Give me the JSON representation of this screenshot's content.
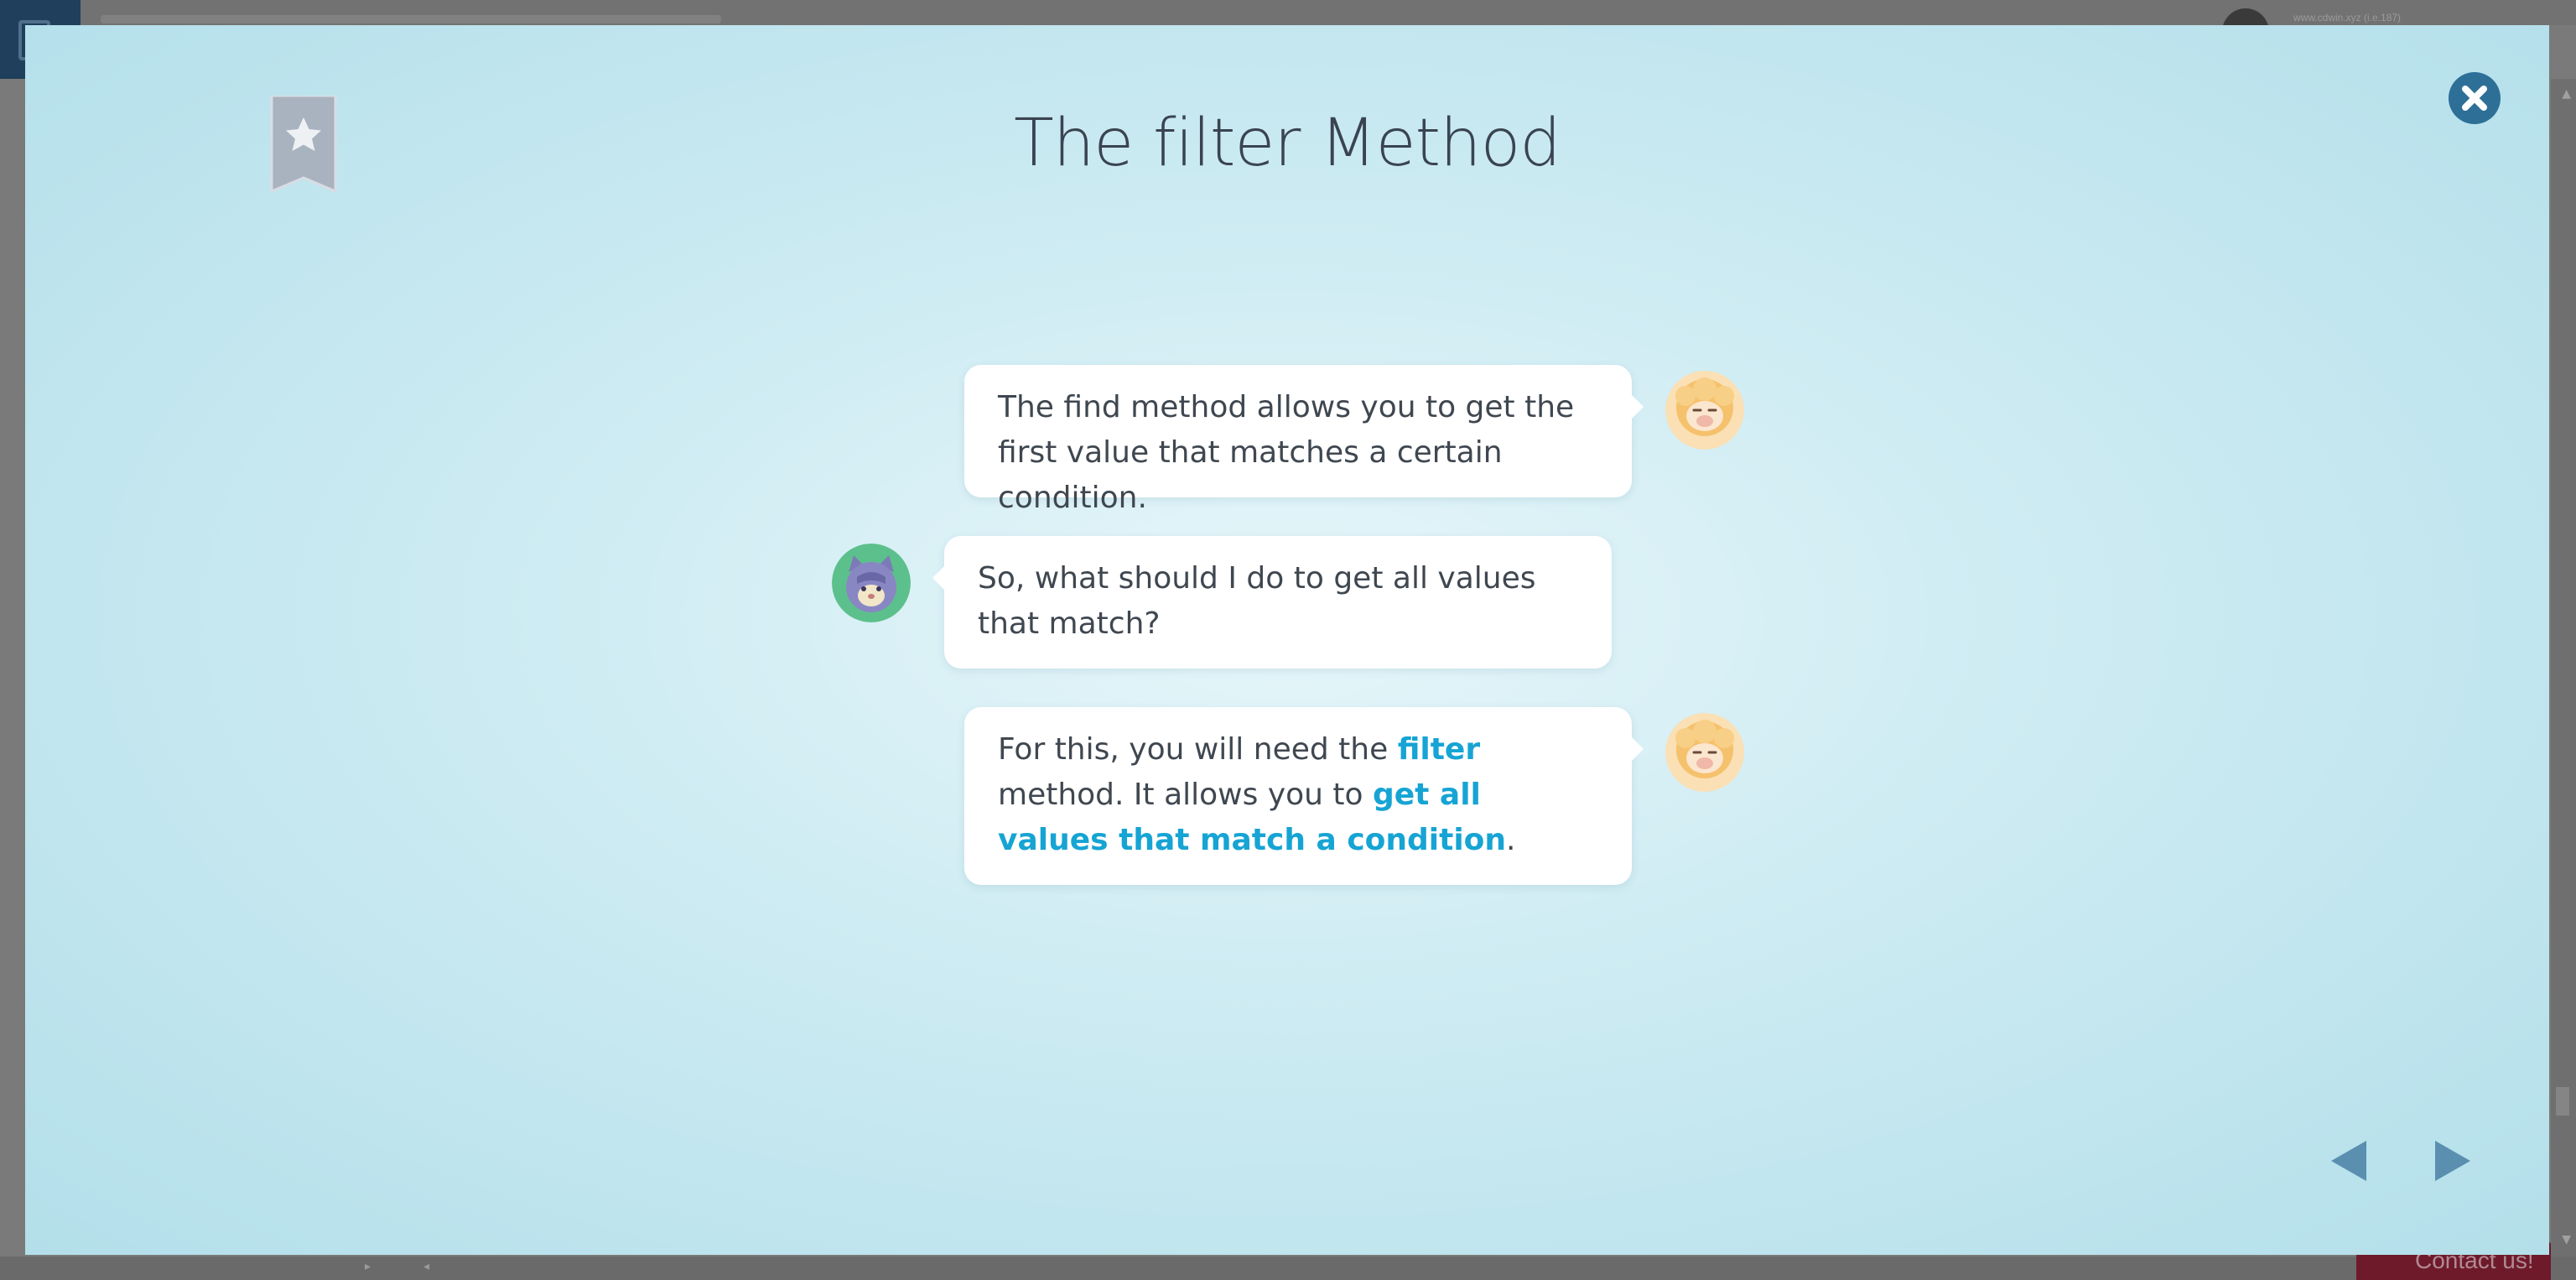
{
  "background": {
    "user_label": "www.cdwin.xyz (i.e.187)",
    "contact_label": "Contact us!"
  },
  "modal": {
    "title": "The filter Method",
    "bookmark_icon": "star-bookmark-icon",
    "close_icon": "close-icon",
    "accent_color": "#16a4d4",
    "close_color": "#2d6f97"
  },
  "chat": {
    "messages": [
      {
        "speaker": "sheep",
        "side": "right",
        "text": "The find method allows you to get the first value that matches a certain condition."
      },
      {
        "speaker": "cat",
        "side": "left",
        "text": "So, what should I do to get all values that match?"
      },
      {
        "speaker": "sheep",
        "side": "right",
        "parts": {
          "t1": "For this, you will need the ",
          "h1": "filter",
          "t2": " method. It allows you to ",
          "h2": "get all values that match a condition",
          "t3": "."
        }
      }
    ]
  },
  "nav": {
    "prev_icon": "triangle-left-icon",
    "next_icon": "triangle-right-icon"
  }
}
